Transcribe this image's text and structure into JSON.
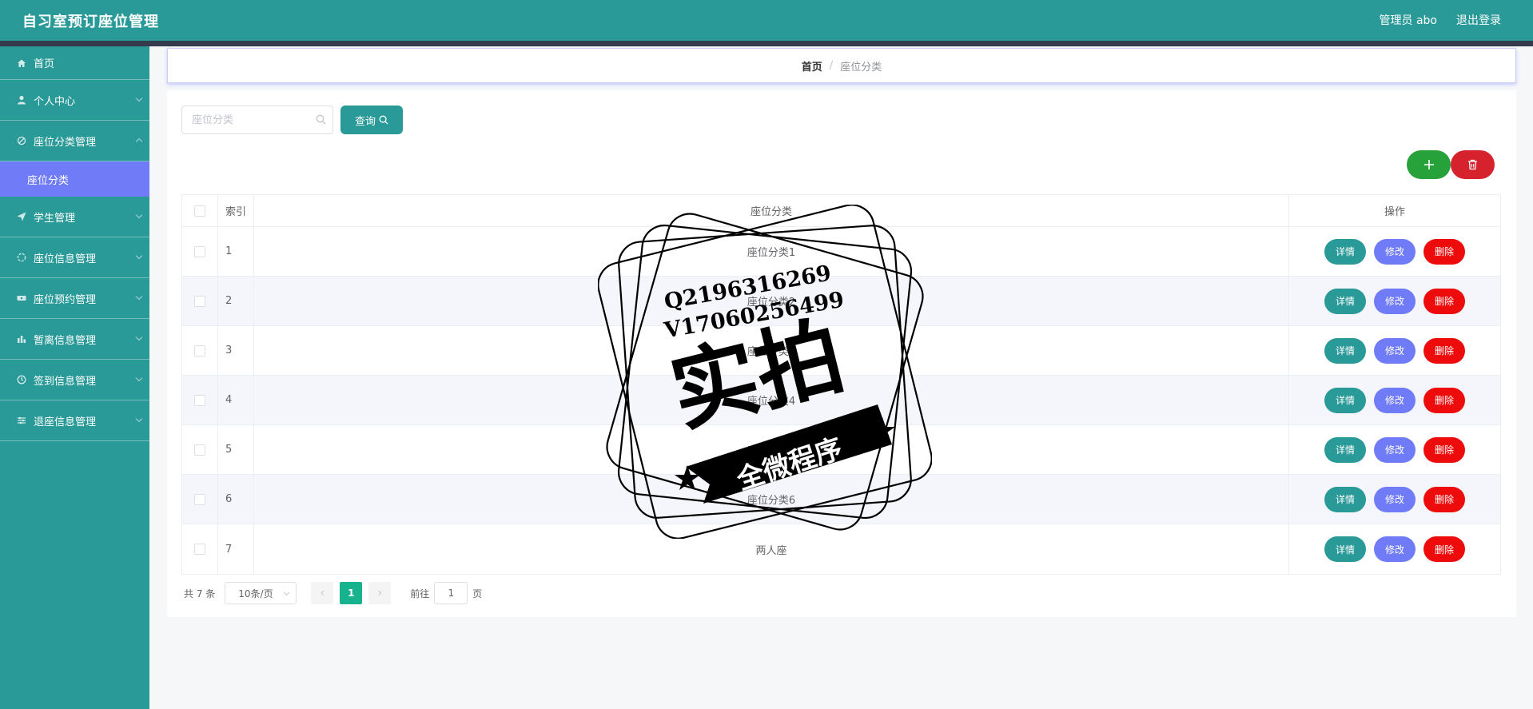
{
  "app": {
    "title": "自习室预订座位管理"
  },
  "header": {
    "user": "管理员 abo",
    "logout": "退出登录"
  },
  "sidebar": {
    "home": {
      "label": "首页",
      "icon": "home-icon"
    },
    "items": [
      {
        "label": "个人中心",
        "icon": "user-icon"
      },
      {
        "label": "座位分类管理",
        "icon": "category-icon"
      },
      {
        "label": "学生管理",
        "icon": "paper-plane-icon"
      },
      {
        "label": "座位信息管理",
        "icon": "info-icon"
      },
      {
        "label": "座位预约管理",
        "icon": "ticket-icon"
      },
      {
        "label": "暂离信息管理",
        "icon": "bar-chart-icon"
      },
      {
        "label": "签到信息管理",
        "icon": "clock-icon"
      },
      {
        "label": "退座信息管理",
        "icon": "sliders-icon"
      }
    ],
    "submenu": {
      "label": "座位分类"
    }
  },
  "breadcrumb": {
    "home": "首页",
    "separator": "/",
    "current": "座位分类"
  },
  "search": {
    "placeholder": "座位分类",
    "button": "查询"
  },
  "table": {
    "columns": {
      "index": "索引",
      "name": "座位分类",
      "ops": "操作"
    },
    "rows": [
      {
        "index": "1",
        "name": "座位分类1"
      },
      {
        "index": "2",
        "name": "座位分类2"
      },
      {
        "index": "3",
        "name": "座位分类3"
      },
      {
        "index": "4",
        "name": "座位分类4"
      },
      {
        "index": "5",
        "name": "座位分类5"
      },
      {
        "index": "6",
        "name": "座位分类6"
      },
      {
        "index": "7",
        "name": "两人座"
      }
    ],
    "actions": {
      "detail": "详情",
      "edit": "修改",
      "delete": "删除"
    }
  },
  "pagination": {
    "total": "共 7 条",
    "page_size": "10条/页",
    "prev": "‹",
    "current_page": "1",
    "next": "›",
    "goto_prefix": "前往",
    "goto_value": "1",
    "goto_suffix": "页"
  },
  "watermark": {
    "line1": "Q2196316269",
    "line2": "V17060256499",
    "main": "实拍",
    "banner": "全微程序"
  },
  "colors": {
    "primary": "#2a9a98",
    "accent": "#6f7bf7",
    "danger": "#ee0b0b",
    "success": "#27a13a",
    "pager_active": "#18b28f"
  }
}
